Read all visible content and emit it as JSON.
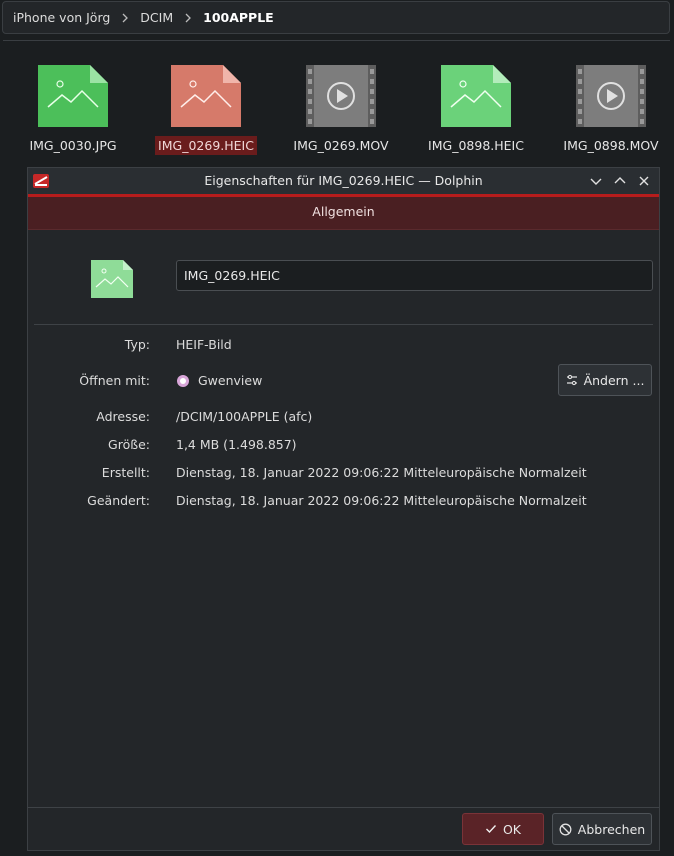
{
  "breadcrumb": [
    "iPhone von Jörg",
    "DCIM",
    "100APPLE"
  ],
  "files": [
    {
      "name": "IMG_0030.JPG",
      "kind": "image",
      "color": "#4cbf5a",
      "selected": false
    },
    {
      "name": "IMG_0269.HEIC",
      "kind": "image",
      "color": "#d67a6a",
      "selected": true
    },
    {
      "name": "IMG_0269.MOV",
      "kind": "video",
      "color": "#7d7d7d",
      "selected": false
    },
    {
      "name": "IMG_0898.HEIC",
      "kind": "image",
      "color": "#6bd27a",
      "selected": false
    },
    {
      "name": "IMG_0898.MOV",
      "kind": "video",
      "color": "#7d7d7d",
      "selected": false
    }
  ],
  "dialog": {
    "title": "Eigenschaften für IMG_0269.HEIC — Dolphin",
    "tab": "Allgemein",
    "filename": "IMG_0269.HEIC",
    "fields": {
      "type_label": "Typ:",
      "type_value": "HEIF-Bild",
      "open_label": "Öffnen mit:",
      "open_value": "Gwenview",
      "change_button": "Ändern ...",
      "address_label": "Adresse:",
      "address_value": "/DCIM/100APPLE (afc)",
      "size_label": "Größe:",
      "size_value": "1,4 MB (1.498.857)",
      "created_label": "Erstellt:",
      "created_value": "Dienstag, 18. Januar 2022 09:06:22 Mitteleuropäische Normalzeit",
      "modified_label": "Geändert:",
      "modified_value": "Dienstag, 18. Januar 2022 09:06:22 Mitteleuropäische Normalzeit"
    },
    "ok_button": "OK",
    "cancel_button": "Abbrechen"
  },
  "colors": {
    "accent": "#b71c1c",
    "tab_bg": "#4a1f22",
    "selection": "#6a1c1c"
  }
}
